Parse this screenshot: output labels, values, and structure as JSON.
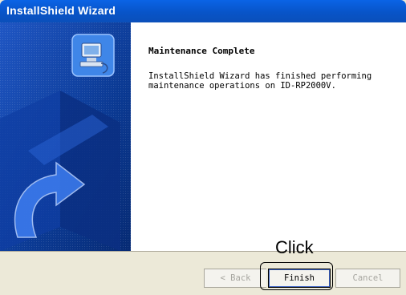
{
  "window": {
    "title": "InstallShield Wizard"
  },
  "main": {
    "heading": "Maintenance Complete",
    "message": "InstallShield Wizard has finished performing\nmaintenance operations on ID-RP2000V."
  },
  "buttons": {
    "back_label": "< Back",
    "finish_label": "Finish",
    "cancel_label": "Cancel"
  },
  "annotation": {
    "label": "Click"
  },
  "icons": {
    "wizard_graphic": "installer-computer-icon",
    "arrow_graphic": "curved-arrow-icon"
  },
  "colors": {
    "titlebar": "#0854c8",
    "side_panel": "#0b3a94",
    "footer": "#ece9d8"
  }
}
